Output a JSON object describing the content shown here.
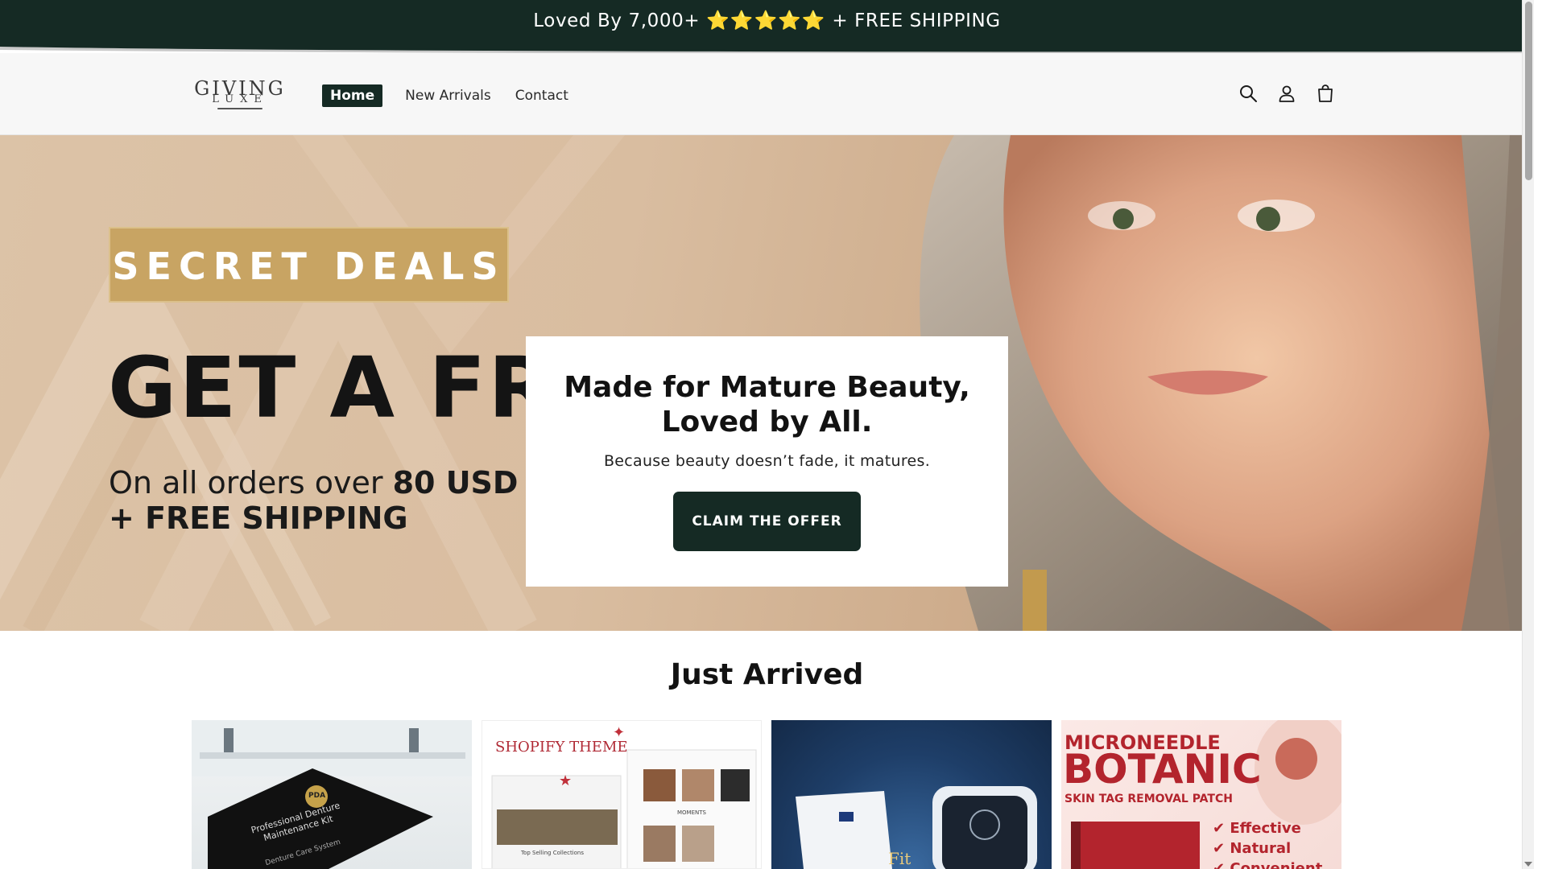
{
  "announcement": {
    "lead": "Loved By 7,000+",
    "stars": "⭐⭐⭐⭐⭐",
    "tail": "+ FREE SHIPPING"
  },
  "header": {
    "logo_line1": "GIVING",
    "logo_line2": "LUXE",
    "nav": [
      {
        "label": "Home",
        "active": true
      },
      {
        "label": "New Arrivals"
      },
      {
        "label": "Contact"
      }
    ],
    "icons": [
      "search-icon",
      "account-icon",
      "cart-icon"
    ]
  },
  "hero": {
    "badge": "SECRET DEALS",
    "headline": "GET A FREE",
    "orders_prefix": "On all orders over",
    "orders_amount": "80 USD",
    "shipping": "+ FREE SHIPPING",
    "card_title": "Made for Mature Beauty, Loved by All.",
    "card_subtitle": "Because beauty doesn’t fade, it matures.",
    "cta_label": "CLAIM THE OFFER"
  },
  "just_arrived": {
    "title": "Just Arrived",
    "products": [
      {
        "text1": "Professional Denture",
        "text2": "Maintenance Kit",
        "text3": "Denture Care System",
        "badge": "PDA"
      },
      {
        "text1": "SHOPIFY THEME",
        "text2": "MOMENTS",
        "text3": "Top Selling Collections"
      },
      {
        "text1": "Fit"
      },
      {
        "text1": "MICRONEEDLE",
        "text2": "BOTANIC",
        "text3": "SKIN TAG REMOVAL PATCH",
        "b1": "Effective",
        "b2": "Natural",
        "b3": "Convenient"
      }
    ]
  },
  "colors": {
    "brand_dark": "#152a24",
    "gold": "#c8a463",
    "star": "#f5c21b"
  }
}
